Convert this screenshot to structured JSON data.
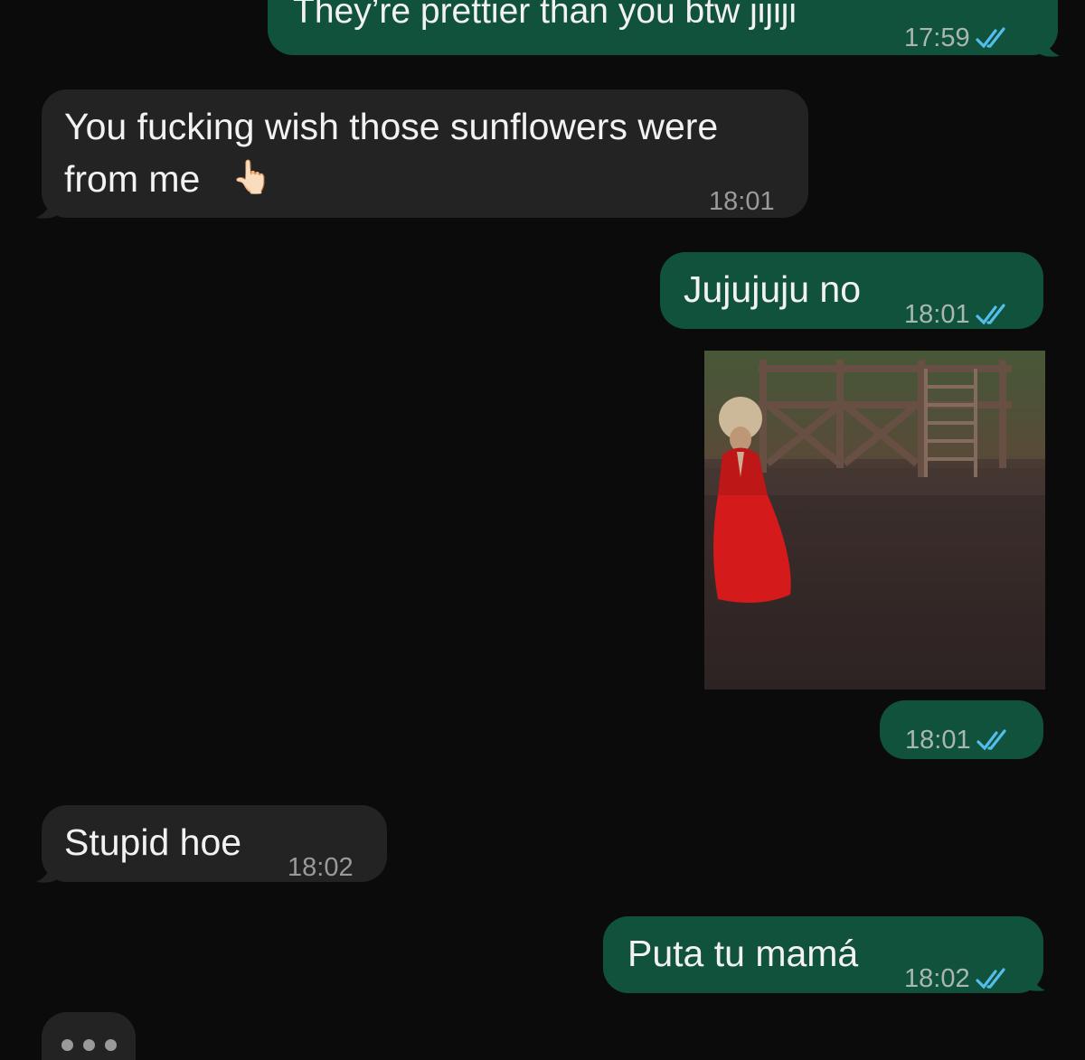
{
  "messages": [
    {
      "id": "m1",
      "direction": "outgoing",
      "text": "They’re prettier than you btw jijiji",
      "time": "17:59",
      "status": "read"
    },
    {
      "id": "m2",
      "direction": "incoming",
      "text_line1": "You fucking wish those sunflowers were",
      "text_line2": "from me",
      "emoji": "👆🏻",
      "time": "18:01"
    },
    {
      "id": "m3",
      "direction": "outgoing",
      "text": "Jujujuju no",
      "time": "18:01",
      "status": "read"
    },
    {
      "id": "m4",
      "direction": "outgoing",
      "type": "video-sticker",
      "time": "18:01",
      "status": "read"
    },
    {
      "id": "m5",
      "direction": "incoming",
      "text": "Stupid hoe",
      "time": "18:02"
    },
    {
      "id": "m6",
      "direction": "outgoing",
      "text": "Puta tu mamá",
      "time": "18:02",
      "status": "read"
    }
  ],
  "typing_indicator": {
    "visible": true
  },
  "colors": {
    "background": "#0b0b0b",
    "outgoing_bubble": "#11523d",
    "incoming_bubble": "#232323",
    "read_ticks": "#53bdeb"
  },
  "icons": {
    "read_ticks": "double-check-icon"
  }
}
